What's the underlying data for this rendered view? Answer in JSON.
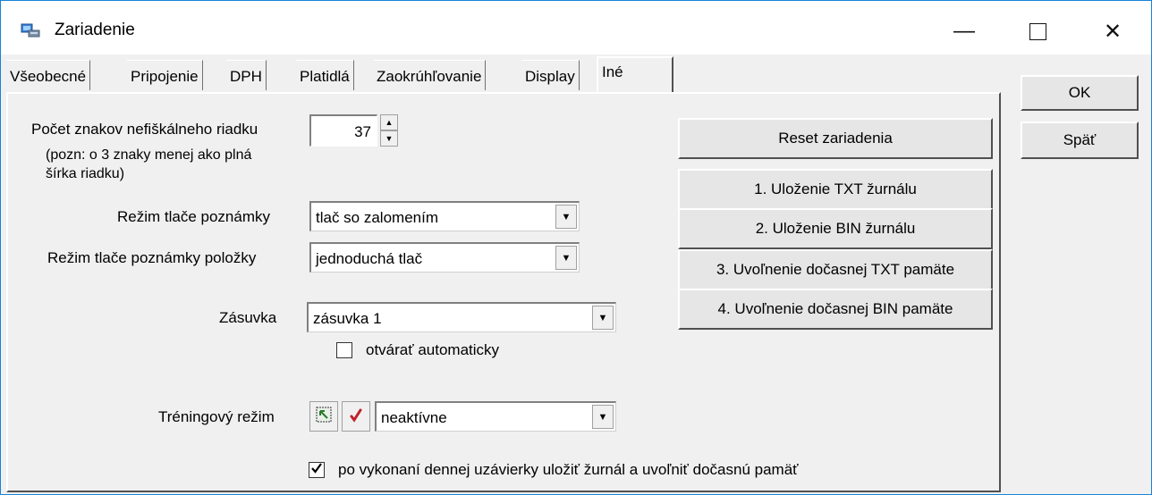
{
  "window": {
    "title": "Zariadenie",
    "controls": {
      "minimize": "—",
      "close": "✕"
    }
  },
  "tabs": [
    {
      "label": "Všeobecné"
    },
    {
      "label": "Pripojenie"
    },
    {
      "label": "DPH"
    },
    {
      "label": "Platidlá"
    },
    {
      "label": "Zaokrúhľovanie"
    },
    {
      "label": "Display"
    },
    {
      "label": "Iné",
      "active": true
    }
  ],
  "dialog_buttons": {
    "ok": "OK",
    "back": "Späť"
  },
  "form": {
    "char_count_label": "Počet znakov nefiškálneho riadku",
    "char_count_value": "37",
    "char_note_line1": "(pozn: o 3 znaky menej ako plná",
    "char_note_line2": "šírka riadku)",
    "note_mode_label": "Režim tlače poznámky",
    "note_mode_value": "tlač so zalomením",
    "item_note_mode_label": "Režim tlače poznámky položky",
    "item_note_mode_value": "jednoduchá tlač",
    "drawer_label": "Zásuvka",
    "drawer_value": "zásuvka 1",
    "auto_open_label": "otvárať automaticky",
    "auto_open_checked": false,
    "training_label": "Tréningový režim",
    "training_value": "neaktívne",
    "save_journal_label": "po vykonaní dennej uzávierky uložiť žurnál a uvoľniť dočasnú pamäť",
    "save_journal_checked": true
  },
  "actions": {
    "reset": "Reset zariadenia",
    "save_txt": "1. Uloženie TXT žurnálu",
    "save_bin": "2. Uloženie BIN žurnálu",
    "free_txt": "3. Uvoľnenie dočasnej TXT pamäte",
    "free_bin": "4. Uvoľnenie dočasnej BIN pamäte"
  },
  "colors": {
    "window_border": "#1883d7",
    "background": "#f0f0f0"
  }
}
